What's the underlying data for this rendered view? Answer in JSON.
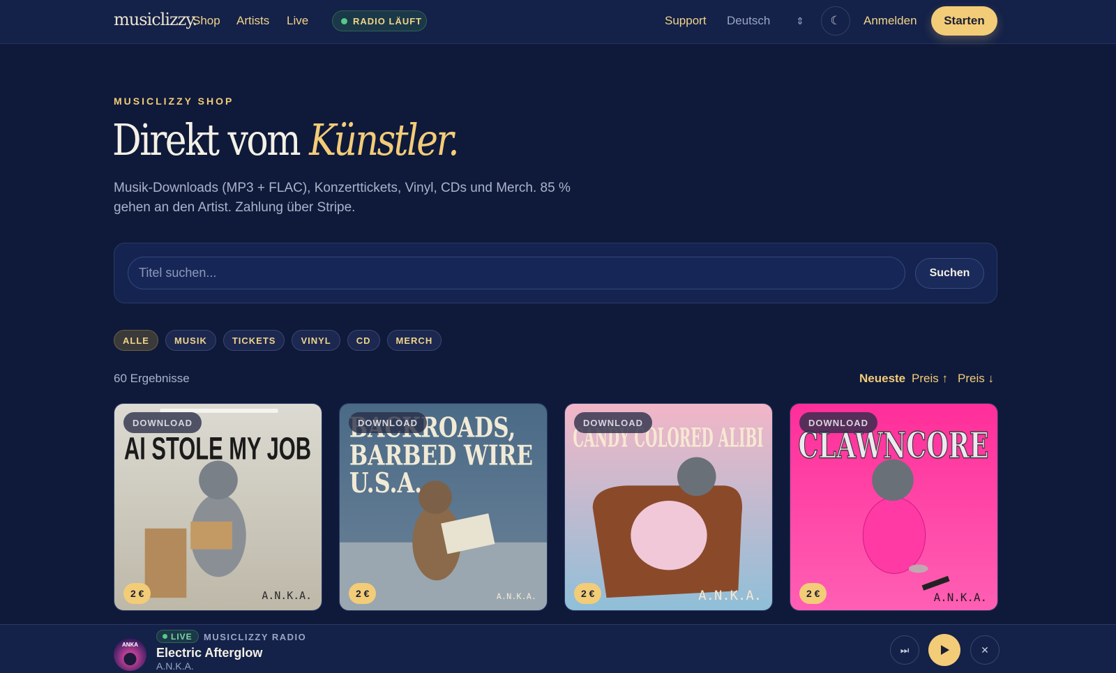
{
  "nav": {
    "logo": "musiclizzy.",
    "links": [
      "Shop",
      "Artists",
      "Live"
    ],
    "radio_status": "RADIO LÄUFT",
    "support": "Support",
    "language": "Deutsch",
    "login": "Anmelden",
    "start": "Starten"
  },
  "hero": {
    "eyebrow": "MUSICLIZZY SHOP",
    "title_main": "Direkt vom",
    "title_accent": "Künstler.",
    "subtitle": "Musik-Downloads (MP3 + FLAC), Konzerttickets, Vinyl, CDs und Merch. 85 % gehen an den Artist. Zahlung über Stripe."
  },
  "search": {
    "placeholder": "Titel suchen...",
    "value": "",
    "button": "Suchen"
  },
  "filters": [
    "ALLE",
    "MUSIK",
    "TICKETS",
    "VINYL",
    "CD",
    "MERCH"
  ],
  "active_filter": "ALLE",
  "results": {
    "count": "60 Ergebnisse",
    "sort": [
      "Neueste",
      "Preis ↑",
      "Preis ↓"
    ],
    "active_sort": "Neueste"
  },
  "products": [
    {
      "badge": "DOWNLOAD",
      "cover_title": "AI STOLE MY JOB",
      "artist": "A.N.K.A.",
      "price": "2 €",
      "colors": {
        "top": "#dcdad2",
        "bottom": "#bdb8a8",
        "text": "#1b1b1b"
      }
    },
    {
      "badge": "DOWNLOAD",
      "cover_title": "BACKROADS, BARBED WIRE U.S.A.",
      "artist": "A.N.K.A.",
      "price": "2 €",
      "colors": {
        "top": "#4a6a86",
        "bottom": "#6d8399",
        "text": "#f1ead6"
      }
    },
    {
      "badge": "DOWNLOAD",
      "cover_title": "CANDY COLORED ALIBI",
      "artist": "A.N.K.A.",
      "price": "2 €",
      "colors": {
        "top": "#f2b6c7",
        "bottom": "#8fbfd8",
        "text": "#f7e8d2"
      }
    },
    {
      "badge": "DOWNLOAD",
      "cover_title": "CLAWNCORE",
      "artist": "A.N.K.A.",
      "price": "2 €",
      "colors": {
        "top": "#ff2e9a",
        "bottom": "#ff5fb4",
        "text": "#eceaf0"
      }
    }
  ],
  "player": {
    "live": "LIVE",
    "station": "MUSICLIZZY RADIO",
    "track": "Electric Afterglow",
    "artist": "A.N.K.A.",
    "cover_text": "ANKA"
  },
  "colors": {
    "background": "#0f1a3a",
    "accent": "#f3cc78",
    "live_green": "#55c88a"
  }
}
